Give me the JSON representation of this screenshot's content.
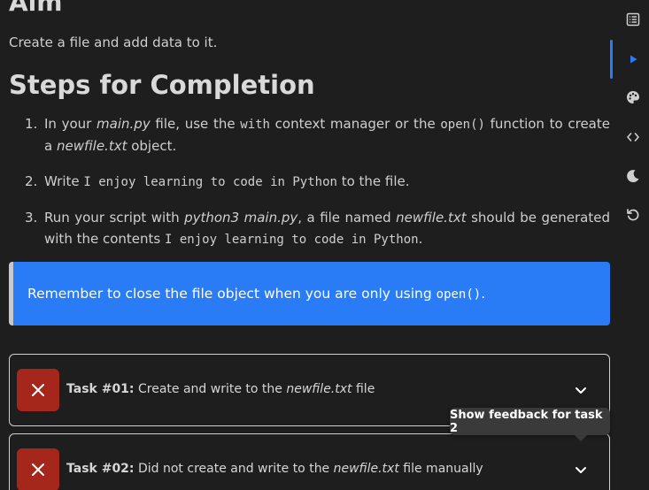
{
  "aim": {
    "title": "Aim",
    "description": "Create a file and add data to it."
  },
  "steps": {
    "title": "Steps for Completion",
    "items": [
      {
        "num": "1.",
        "parts": [
          "In your ",
          "main.py",
          " file, use the ",
          "with",
          " context manager or the ",
          "open()",
          " function to create a ",
          "newfile.txt",
          " object."
        ]
      },
      {
        "num": "2.",
        "parts": [
          "Write ",
          "I enjoy learning to code in Python",
          " to the file."
        ]
      },
      {
        "num": "3.",
        "parts": [
          "Run your script with ",
          "python3 main.py",
          ", a file named ",
          "newfile.txt",
          " should be generated with the contents ",
          "I enjoy learning to code in Python",
          "."
        ]
      }
    ]
  },
  "note": {
    "text_before": "Remember to close the file object when you are only using ",
    "code": "open()",
    "text_after": "."
  },
  "tasks": [
    {
      "label": "Task #01:",
      "text_before": " Create and write to the ",
      "file": "newfile.txt",
      "text_after": " file",
      "status": "failed"
    },
    {
      "label": "Task #02:",
      "text_before": " Did not create and write to the ",
      "file": "newfile.txt",
      "text_after": " file manually",
      "status": "failed"
    }
  ],
  "tooltip": {
    "text": "Show feedback for task 2"
  },
  "sidebar": {
    "icons": [
      "list-icon",
      "play-icon",
      "palette-icon",
      "code-icon",
      "moon-icon",
      "reset-icon"
    ],
    "active": "play-icon"
  },
  "colors": {
    "accent": "#2a7cf6",
    "fail": "#a5271c",
    "background": "#1e1e1e"
  }
}
